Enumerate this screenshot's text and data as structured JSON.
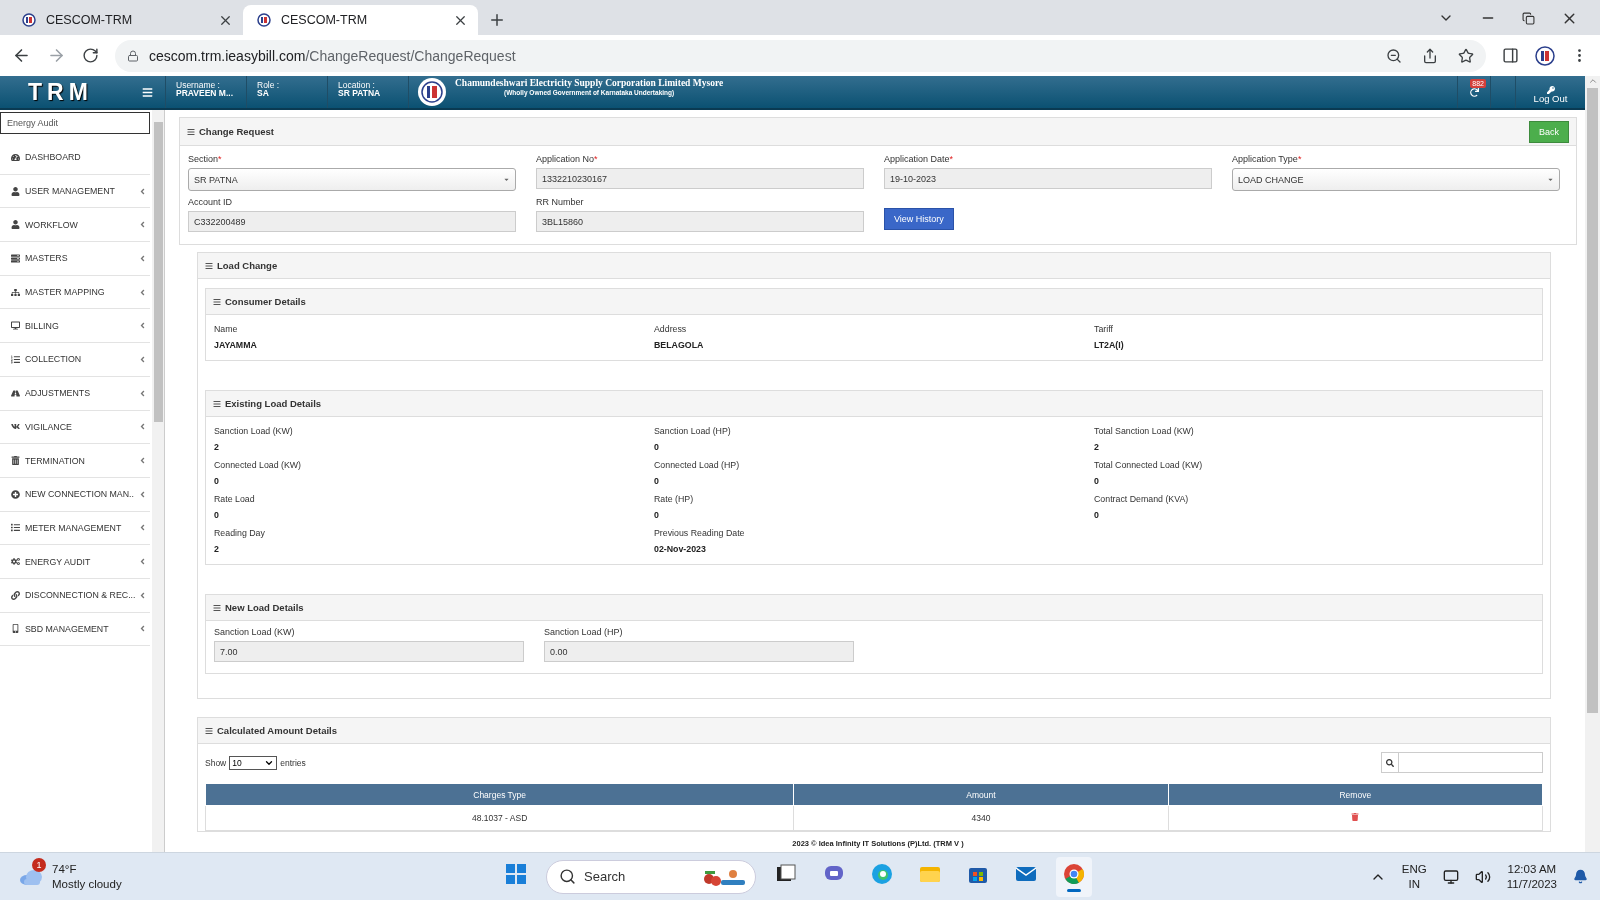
{
  "browser": {
    "tabs": [
      {
        "title": "CESCOM-TRM",
        "selected": false
      },
      {
        "title": "CESCOM-TRM",
        "selected": true
      }
    ],
    "url_host": "cescom.trm.ieasybill.com",
    "url_path": "/ChangeRequest/ChangeRequest"
  },
  "header": {
    "logo": "TRM",
    "user_info": [
      {
        "label": "Username :",
        "value": "PRAVEEN M..."
      },
      {
        "label": "Role :",
        "value": "SA"
      },
      {
        "label": "Location :",
        "value": "SR PATNA"
      }
    ],
    "org_name": "Chamundeshwari Electricity Supply Corporation Limited Mysore",
    "org_subtitle": "(Wholly Owned Government of Karnataka Undertaking)",
    "notification_count": "882",
    "logout": "Log Out"
  },
  "sidebar": {
    "search": {
      "value": "Energy Audit"
    },
    "items": [
      {
        "label": "DASHBOARD",
        "expandable": false
      },
      {
        "label": "USER MANAGEMENT",
        "expandable": true
      },
      {
        "label": "WORKFLOW",
        "expandable": true
      },
      {
        "label": "MASTERS",
        "expandable": true
      },
      {
        "label": "MASTER MAPPING",
        "expandable": true
      },
      {
        "label": "BILLING",
        "expandable": true
      },
      {
        "label": "COLLECTION",
        "expandable": true
      },
      {
        "label": "ADJUSTMENTS",
        "expandable": true
      },
      {
        "label": "VIGILANCE",
        "expandable": true
      },
      {
        "label": "TERMINATION",
        "expandable": true
      },
      {
        "label": "NEW CONNECTION MAN..",
        "expandable": true
      },
      {
        "label": "METER MANAGEMENT",
        "expandable": true
      },
      {
        "label": "ENERGY AUDIT",
        "expandable": true
      },
      {
        "label": "DISCONNECTION & REC...",
        "expandable": true
      },
      {
        "label": "SBD MANAGEMENT",
        "expandable": true
      }
    ]
  },
  "change_request": {
    "title": "Change Request",
    "back": "Back",
    "required_mark": "*",
    "fields": [
      {
        "label": "Section",
        "required": true,
        "value": "SR PATNA",
        "kind": "select"
      },
      {
        "label": "Application No",
        "required": true,
        "value": "1332210230167",
        "kind": "text"
      },
      {
        "label": "Application Date",
        "required": true,
        "value": "19-10-2023",
        "kind": "text"
      },
      {
        "label": "Application Type",
        "required": true,
        "value": "LOAD CHANGE",
        "kind": "select"
      },
      {
        "label": "Account ID",
        "required": false,
        "value": "C332200489",
        "kind": "text"
      },
      {
        "label": "RR Number",
        "required": false,
        "value": "3BL15860",
        "kind": "text"
      }
    ],
    "history_button": "View History"
  },
  "load_change": {
    "title": "Load Change",
    "consumer": {
      "title": "Consumer Details",
      "items": [
        {
          "label": "Name",
          "value": "JAYAMMA"
        },
        {
          "label": "Address",
          "value": "BELAGOLA"
        },
        {
          "label": "Tariff",
          "value": "LT2A(I)"
        }
      ]
    },
    "existing": {
      "title": "Existing Load Details",
      "items": [
        {
          "label": "Sanction Load (KW)",
          "value": "2"
        },
        {
          "label": "Sanction Load (HP)",
          "value": "0"
        },
        {
          "label": "Total Sanction Load (KW)",
          "value": "2"
        },
        {
          "label": "Connected Load (KW)",
          "value": "0"
        },
        {
          "label": "Connected Load (HP)",
          "value": "0"
        },
        {
          "label": "Total Connected Load (KW)",
          "value": "0"
        },
        {
          "label": "Rate Load",
          "value": "0"
        },
        {
          "label": "Rate (HP)",
          "value": "0"
        },
        {
          "label": "Contract Demand (KVA)",
          "value": "0"
        },
        {
          "label": "Reading Day",
          "value": "2"
        },
        {
          "label": "Previous Reading Date",
          "value": "02-Nov-2023"
        }
      ]
    },
    "new_load": {
      "title": "New Load Details",
      "fields": [
        {
          "label": "Sanction Load (KW)",
          "value": "7.00"
        },
        {
          "label": "Sanction Load (HP)",
          "value": "0.00"
        }
      ]
    }
  },
  "amounts": {
    "title": "Calculated Amount Details",
    "show_label": "Show",
    "page_size": "10",
    "entries_label": "entries",
    "columns": [
      "Charges Type",
      "Amount",
      "Remove"
    ],
    "rows": [
      {
        "charges_type": "48.1037 - ASD",
        "amount": "4340"
      }
    ]
  },
  "footer": "2023 © Idea Infinity IT Solutions (P)Ltd. (TRM V )",
  "taskbar": {
    "weather": {
      "badge": "1",
      "temp": "74°F",
      "condition": "Mostly cloudy"
    },
    "search_placeholder": "Search",
    "apps": [
      {
        "selected": false
      },
      {
        "selected": false
      },
      {
        "selected": false
      },
      {
        "selected": false
      },
      {
        "selected": false
      },
      {
        "selected": false
      },
      {
        "selected": false
      },
      {
        "selected": true
      }
    ],
    "lang": "ENG",
    "region": "IN",
    "time": "12:03 AM",
    "date": "11/7/2023"
  }
}
